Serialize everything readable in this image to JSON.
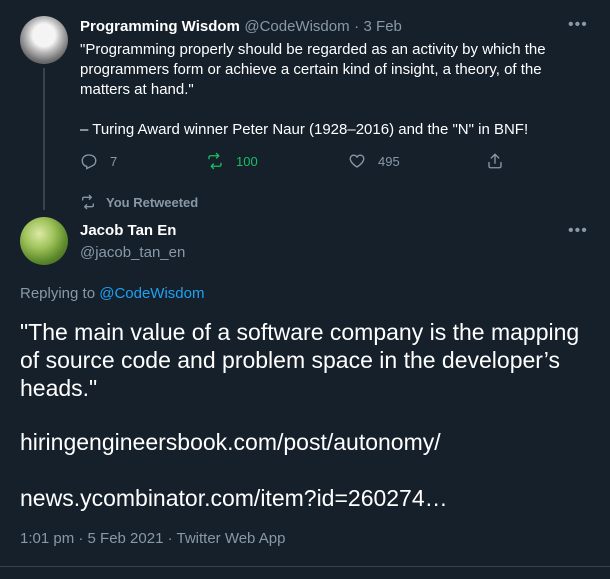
{
  "parent_tweet": {
    "author_name": "Programming Wisdom",
    "author_handle": "@CodeWisdom",
    "separator": "·",
    "date": "3 Feb",
    "quote_line": "\"Programming properly should be regarded as an activity by which the programmers form or achieve a certain kind of insight, a theory, of the matters at hand.\"",
    "attribution": "– Turing Award winner Peter Naur (1928–2016) and the \"N\" in BNF!",
    "reply_count": "7",
    "retweet_count": "100",
    "like_count": "495",
    "icons": [
      "reply-icon",
      "retweet-icon",
      "like-icon",
      "share-icon",
      "more-icon"
    ],
    "colors": {
      "retweeted": "#17bf63"
    }
  },
  "retweet_context": {
    "label": "You Retweeted",
    "icon": "retweet-icon"
  },
  "reply_tweet": {
    "author_name": "Jacob Tan En",
    "author_handle": "@jacob_tan_en",
    "replying_to_prefix": "Replying to",
    "replying_to_handle": "@CodeWisdom",
    "text": "\"The main value of a software company is the mapping of source code and problem space in the developer’s heads.\"",
    "link1": "hiringengineersbook.com/post/autonomy/",
    "link2": "news.ycombinator.com/item?id=260274…",
    "timestamp": "1:01 pm · 5 Feb 2021 · Twitter Web App"
  },
  "theme": {
    "background": "#15202b",
    "text": "#ffffff",
    "muted": "#8899a6",
    "accent": "#1da1f2",
    "border": "#38444d"
  }
}
